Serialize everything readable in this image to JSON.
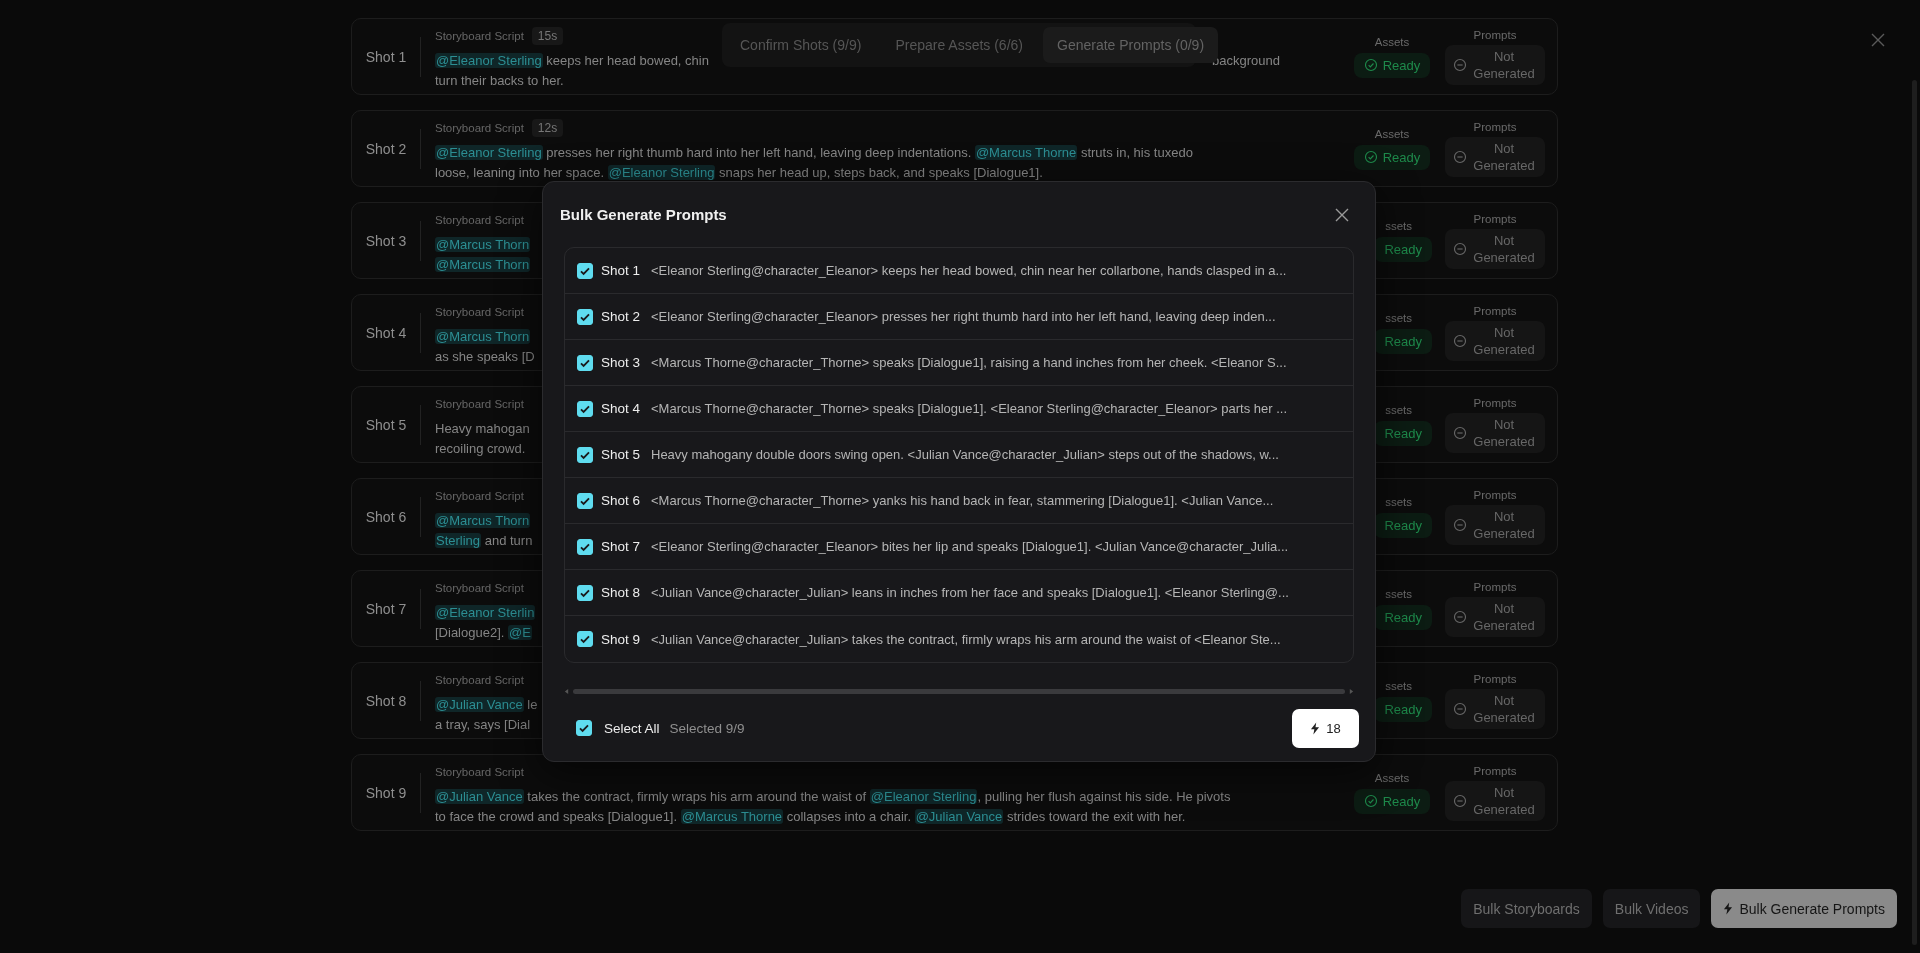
{
  "tabs": [
    {
      "label": "Confirm Shots (9/9)",
      "selected": false
    },
    {
      "label": "Prepare Assets (6/6)",
      "selected": false
    },
    {
      "label": "Generate Prompts (0/9)",
      "selected": true
    }
  ],
  "shots": [
    {
      "label": "Shot 1",
      "script_label": "Storyboard Script",
      "duration": "15s",
      "lines": [
        [
          {
            "kind": "mention",
            "text": "@Eleanor Sterling"
          },
          {
            "kind": "text",
            "text": " keeps her head bowed, chin"
          },
          {
            "kind": "gap"
          },
          {
            "kind": "text",
            "text": "background"
          }
        ],
        [
          {
            "kind": "text",
            "text": "turn their backs to her."
          }
        ]
      ],
      "assets": {
        "label": "Assets",
        "status": "Ready",
        "icon": true
      },
      "prompts": {
        "label": "Prompts",
        "status": "Not Generated"
      }
    },
    {
      "label": "Shot 2",
      "script_label": "Storyboard Script",
      "duration": "12s",
      "lines": [
        [
          {
            "kind": "mention",
            "text": "@Eleanor Sterling"
          },
          {
            "kind": "text",
            "text": " presses her right thumb hard into her left hand, leaving deep indentations. "
          },
          {
            "kind": "mention",
            "text": "@Marcus Thorne"
          },
          {
            "kind": "text",
            "text": " struts in, his tuxedo"
          }
        ],
        [
          {
            "kind": "text",
            "text": "loose, leaning into her space. "
          },
          {
            "kind": "mention",
            "text": "@Eleanor Sterling"
          },
          {
            "kind": "text",
            "text": " snaps her head up, steps back, and speaks [Dialogue1]."
          }
        ]
      ],
      "assets": {
        "label": "Assets",
        "status": "Ready",
        "icon": true
      },
      "prompts": {
        "label": "Prompts",
        "status": "Not Generated"
      }
    },
    {
      "label": "Shot 3",
      "script_label": "Storyboard Script",
      "lines": [
        [
          {
            "kind": "mention",
            "text": "@Marcus Thorn"
          }
        ],
        [
          {
            "kind": "mention",
            "text": "@Marcus Thorn"
          }
        ]
      ],
      "assets": {
        "label": "ssets",
        "status": "Ready",
        "icon": false
      },
      "prompts": {
        "label": "Prompts",
        "status": "Not Generated"
      }
    },
    {
      "label": "Shot 4",
      "script_label": "Storyboard Script",
      "lines": [
        [
          {
            "kind": "mention",
            "text": "@Marcus Thorn"
          }
        ],
        [
          {
            "kind": "text",
            "text": "as she speaks [D"
          }
        ]
      ],
      "assets": {
        "label": "ssets",
        "status": "Ready",
        "icon": false
      },
      "prompts": {
        "label": "Prompts",
        "status": "Not Generated"
      }
    },
    {
      "label": "Shot 5",
      "script_label": "Storyboard Script",
      "lines": [
        [
          {
            "kind": "text",
            "text": "Heavy mahogan"
          }
        ],
        [
          {
            "kind": "text",
            "text": "recoiling crowd."
          }
        ]
      ],
      "assets": {
        "label": "ssets",
        "status": "Ready",
        "icon": false
      },
      "prompts": {
        "label": "Prompts",
        "status": "Not Generated"
      }
    },
    {
      "label": "Shot 6",
      "script_label": "Storyboard Script",
      "lines": [
        [
          {
            "kind": "mention",
            "text": "@Marcus Thorn"
          }
        ],
        [
          {
            "kind": "mention",
            "text": "Sterling"
          },
          {
            "kind": "text",
            "text": " and turn"
          }
        ]
      ],
      "assets": {
        "label": "ssets",
        "status": "Ready",
        "icon": false
      },
      "prompts": {
        "label": "Prompts",
        "status": "Not Generated"
      }
    },
    {
      "label": "Shot 7",
      "script_label": "Storyboard Script",
      "lines": [
        [
          {
            "kind": "mention",
            "text": "@Eleanor Sterlin"
          }
        ],
        [
          {
            "kind": "text",
            "text": "[Dialogue2]. "
          },
          {
            "kind": "mention",
            "text": "@E"
          }
        ]
      ],
      "assets": {
        "label": "ssets",
        "status": "Ready",
        "icon": false
      },
      "prompts": {
        "label": "Prompts",
        "status": "Not Generated"
      }
    },
    {
      "label": "Shot 8",
      "script_label": "Storyboard Script",
      "lines": [
        [
          {
            "kind": "mention",
            "text": "@Julian Vance"
          },
          {
            "kind": "text",
            "text": " le"
          }
        ],
        [
          {
            "kind": "text",
            "text": "a tray, says [Dial"
          }
        ]
      ],
      "assets": {
        "label": "ssets",
        "status": "Ready",
        "icon": false
      },
      "prompts": {
        "label": "Prompts",
        "status": "Not Generated"
      }
    },
    {
      "label": "Shot 9",
      "script_label": "Storyboard Script",
      "lines": [
        [
          {
            "kind": "mention",
            "text": "@Julian Vance"
          },
          {
            "kind": "text",
            "text": " takes the contract, firmly wraps his arm around the waist of "
          },
          {
            "kind": "mention",
            "text": "@Eleanor Sterling"
          },
          {
            "kind": "text",
            "text": ", pulling her flush against his side. He pivots"
          }
        ],
        [
          {
            "kind": "text",
            "text": "to face the crowd and speaks [Dialogue1]. "
          },
          {
            "kind": "mention",
            "text": "@Marcus Thorne"
          },
          {
            "kind": "text",
            "text": " collapses into a chair. "
          },
          {
            "kind": "mention",
            "text": "@Julian Vance"
          },
          {
            "kind": "text",
            "text": " strides toward the exit with her."
          }
        ]
      ],
      "assets": {
        "label": "Assets",
        "status": "Ready",
        "icon": true
      },
      "prompts": {
        "label": "Prompts",
        "status": "Not Generated"
      }
    }
  ],
  "bulk_buttons": [
    {
      "label": "Bulk Storyboards",
      "primary": false
    },
    {
      "label": "Bulk Videos",
      "primary": false
    },
    {
      "label": "Bulk Generate Prompts",
      "primary": true
    }
  ],
  "modal": {
    "title": "Bulk Generate Prompts",
    "rows": [
      {
        "label": "Shot 1",
        "prompt": "<Eleanor Sterling@character_Eleanor> keeps her head bowed, chin near her collarbone, hands clasped in a...",
        "checked": true
      },
      {
        "label": "Shot 2",
        "prompt": "<Eleanor Sterling@character_Eleanor> presses her right thumb hard into her left hand, leaving deep inden...",
        "checked": true
      },
      {
        "label": "Shot 3",
        "prompt": "<Marcus Thorne@character_Thorne> speaks [Dialogue1], raising a hand inches from her cheek. <Eleanor S...",
        "checked": true
      },
      {
        "label": "Shot 4",
        "prompt": "<Marcus Thorne@character_Thorne> speaks [Dialogue1]. <Eleanor Sterling@character_Eleanor> parts her ...",
        "checked": true
      },
      {
        "label": "Shot 5",
        "prompt": "Heavy mahogany double doors swing open. <Julian Vance@character_Julian> steps out of the shadows, w...",
        "checked": true
      },
      {
        "label": "Shot 6",
        "prompt": "<Marcus Thorne@character_Thorne> yanks his hand back in fear, stammering [Dialogue1]. <Julian Vance...",
        "checked": true
      },
      {
        "label": "Shot 7",
        "prompt": "<Eleanor Sterling@character_Eleanor> bites her lip and speaks [Dialogue1]. <Julian Vance@character_Julia...",
        "checked": true
      },
      {
        "label": "Shot 8",
        "prompt": "<Julian Vance@character_Julian> leans in inches from her face and speaks [Dialogue1]. <Eleanor Sterling@...",
        "checked": true
      },
      {
        "label": "Shot 9",
        "prompt": "<Julian Vance@character_Julian> takes the contract, firmly wraps his arm around the waist of <Eleanor Ste...",
        "checked": true
      }
    ],
    "select_all": {
      "label": "Select All",
      "checked": true
    },
    "selected_count": "Selected 9/9",
    "generate_button": "18"
  }
}
